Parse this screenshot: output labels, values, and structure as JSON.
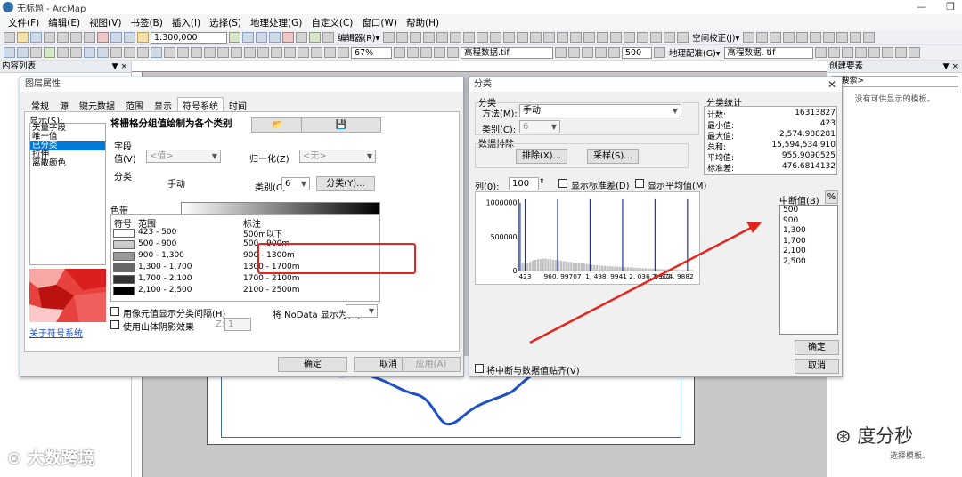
{
  "app": {
    "title": "无标题 - ArcMap",
    "controls": {
      "minimize": "—",
      "restore": "❐"
    },
    "menus": [
      "文件(F)",
      "编辑(E)",
      "视图(V)",
      "书签(B)",
      "插入(I)",
      "选择(S)",
      "地理处理(G)",
      "自定义(C)",
      "窗口(W)",
      "帮助(H)"
    ]
  },
  "toolbar": {
    "scale": "1:300,000",
    "editor_label": "编辑器(R)▾",
    "spatial_adjust_label": "空间校正(J)▾",
    "zoom_percent": "67%",
    "layer_select": "高程数据.tif",
    "resolution_value": "500",
    "georef_label": "地理配准(G)▾",
    "georef_layer": "高程数据. tif"
  },
  "toc": {
    "title": "内容列表",
    "pin": "▼ ×"
  },
  "create_panel": {
    "title": "创建要素",
    "pin": "▼ ×",
    "search_placeholder": "<搜索>",
    "message": "没有可供显示的模板。",
    "bottom_message": "选择模板。"
  },
  "layer_props": {
    "title": "图层属性",
    "tabs": [
      "常规",
      "源",
      "键元数据",
      "范围",
      "显示",
      "符号系统",
      "时间"
    ],
    "show_label": "显示(S):",
    "show_items": [
      "矢量字段",
      "唯一值",
      "已分类",
      "拉伸",
      "离散颜色"
    ],
    "heading": "将栅格分组值绘制为各个类别",
    "field_group": "字段",
    "value_label": "值(V)",
    "value_select": "<值>",
    "normalize_label": "归一化(Z)",
    "normalize_select": "<无>",
    "classify_group": "分类",
    "method": "手动",
    "classes_label": "类别(C)",
    "classes_value": "6",
    "classify_button": "分类(Y)...",
    "colorramp_label": "色带",
    "table_headers": [
      "符号",
      "范围",
      "标注"
    ],
    "rows": [
      {
        "range": "423 - 500",
        "label": "500m以下",
        "color": "#ffffff"
      },
      {
        "range": "500 - 900",
        "label": "500 - 900m",
        "color": "#cccccc"
      },
      {
        "range": "900 - 1,300",
        "label": "900 - 1300m",
        "color": "#999999"
      },
      {
        "range": "1,300 - 1,700",
        "label": "1300 - 1700m",
        "color": "#666666"
      },
      {
        "range": "1,700 - 2,100",
        "label": "1700 - 2100m",
        "color": "#333333"
      },
      {
        "range": "2,100 - 2,500",
        "label": "2100 - 2500m",
        "color": "#000000"
      }
    ],
    "about_link": "关于符号系统",
    "chk_show_class_gaps": "用像元值显示分类间隔(H)",
    "chk_hillshade": "使用山体阴影效果",
    "z_label": "Z:",
    "z_value": "1",
    "nodata_label": "将 NoData 显示为(N)",
    "ok": "确定",
    "cancel": "取消",
    "apply": "应用(A)"
  },
  "classify": {
    "title": "分类",
    "group_title": "分类",
    "method_label": "方法(M):",
    "method_value": "手动",
    "classes_label": "类别(C):",
    "classes_value": "6",
    "exclusion_group": "数据排除",
    "exclusion_button": "排除(X)...",
    "sampling_button": "采样(S)...",
    "stats_title": "分类统计",
    "stats": [
      {
        "k": "计数:",
        "v": "16313827"
      },
      {
        "k": "最小值:",
        "v": "423"
      },
      {
        "k": "最大值:",
        "v": "2,574.988281"
      },
      {
        "k": "总和:",
        "v": "15,594,534,910"
      },
      {
        "k": "平均值:",
        "v": "955.9090525"
      },
      {
        "k": "标准差:",
        "v": "476.6814132"
      }
    ],
    "columns_label": "列(0):",
    "columns_value": "100",
    "chk_stddev": "显示标准差(D)",
    "chk_mean": "显示平均值(M)",
    "breaks_title": "中断值(B)",
    "percent_button": "%",
    "breaks": [
      "500",
      "900",
      "1,300",
      "1,700",
      "2,100",
      "2,500"
    ],
    "snap_label": "将中断与数据值贴齐(V)",
    "ok": "确定",
    "cancel": "取消"
  },
  "chart_data": {
    "type": "bar",
    "x_tick_labels": [
      "423",
      "960. 99707",
      "1, 498. 9941",
      "2, 036. 9912",
      "2, 574. 9882"
    ],
    "y_tick_labels": [
      "1000000",
      "500000",
      "0"
    ],
    "ylim": [
      0,
      1050000
    ],
    "xlim": [
      423,
      2575
    ],
    "break_values": [
      500,
      900,
      1300,
      1700,
      2100,
      2500
    ],
    "bins": [
      1000000,
      120000,
      100000,
      110000,
      130000,
      150000,
      160000,
      170000,
      170000,
      180000,
      180000,
      170000,
      170000,
      160000,
      160000,
      150000,
      150000,
      140000,
      140000,
      130000,
      130000,
      120000,
      120000,
      110000,
      110000,
      105000,
      100000,
      95000,
      90000,
      85000,
      82000,
      78000,
      75000,
      72000,
      70000,
      68000,
      65000,
      62000,
      60000,
      58000,
      56000,
      54000,
      52000,
      50000,
      48000,
      46000,
      44000,
      42000,
      40000,
      38000,
      36000,
      34000,
      32000,
      30000,
      28000,
      26000,
      24000,
      22000,
      20000,
      18000,
      16000,
      14000,
      12000,
      10000,
      8000,
      6000,
      4000,
      2000
    ]
  },
  "watermark": {
    "left": "⊙ 大数跨境",
    "right": "⊛ 度分秒"
  }
}
